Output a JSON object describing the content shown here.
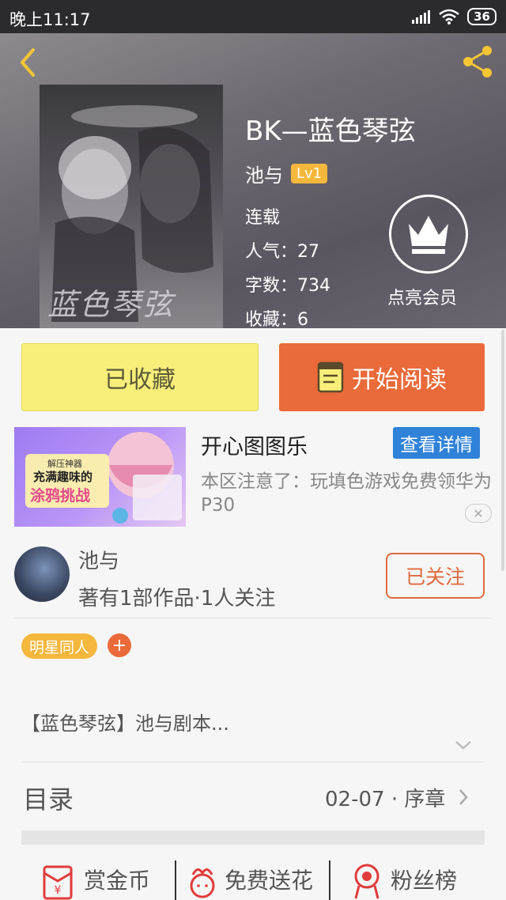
{
  "status_bar": {
    "time": "晚上11:17",
    "battery": "36"
  },
  "book": {
    "title": "BK—蓝色琴弦",
    "author": "池与",
    "level": "Lv1",
    "status": "连载",
    "popularity": "人气：27",
    "word_count": "字数：734",
    "favorites": "收藏：6",
    "cover_text": "蓝色琴弦"
  },
  "vip": {
    "label": "点亮会员"
  },
  "actions": {
    "collected_label": "已收藏",
    "read_label": "开始阅读"
  },
  "ad": {
    "title": "开心图图乐",
    "detail_button": "查看详情",
    "description": "本区注意了：玩填色游戏免费领华为P30",
    "image_text_1": "解压神器",
    "image_text_2": "充满趣味的",
    "image_text_3": "涂鸦挑战"
  },
  "author_card": {
    "name": "池与",
    "summary": "著有1部作品·1人关注",
    "follow_label": "已关注"
  },
  "tags": [
    {
      "label": "明星同人"
    }
  ],
  "tag_add": "+",
  "synopsis": "【蓝色琴弦】池与剧本...",
  "toc": {
    "label": "目录",
    "latest": "02-07 · 序章"
  },
  "bottom_bar": [
    {
      "label": "赏金币",
      "icon": "red-envelope-icon"
    },
    {
      "label": "免费送花",
      "icon": "flower-icon"
    },
    {
      "label": "粉丝榜",
      "icon": "medal-icon"
    }
  ],
  "colors": {
    "accent_orange": "#ea6a3a",
    "collected_yellow": "#f8ef7a",
    "badge_gold": "#f5b73c",
    "ad_blue": "#2f82d8"
  }
}
